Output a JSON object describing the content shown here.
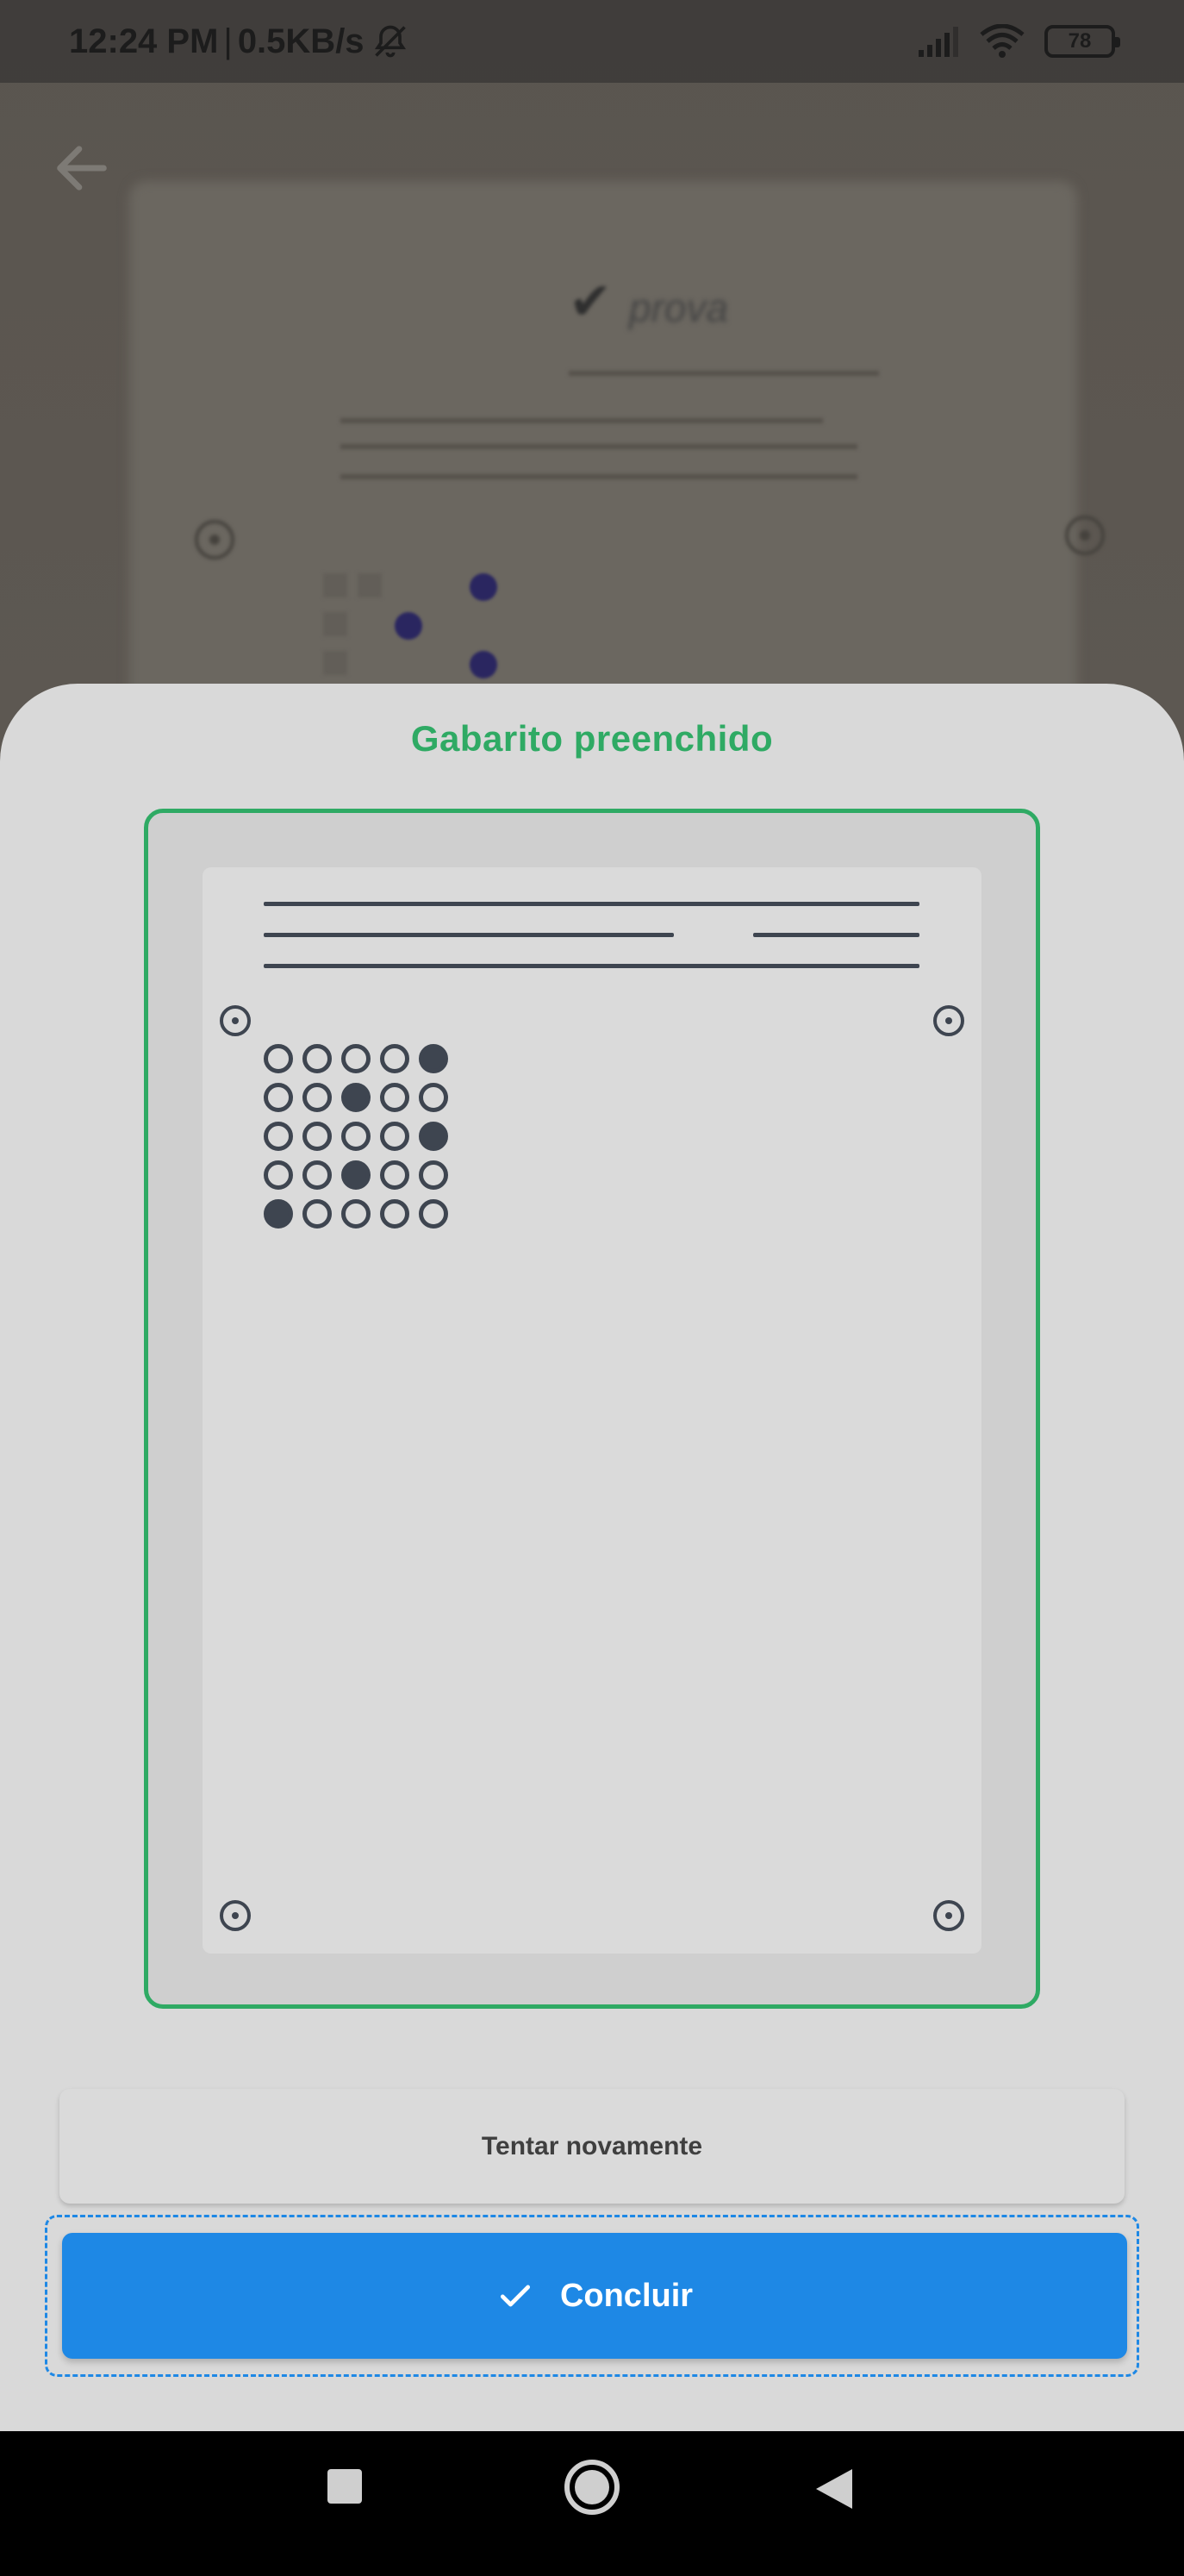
{
  "status_bar": {
    "time": "12:24 PM",
    "separator": "|",
    "speed": "0.5KB/s",
    "battery": "78"
  },
  "sheet": {
    "title": "Gabarito preenchido",
    "answer_grid": [
      [
        0,
        0,
        0,
        0,
        1
      ],
      [
        0,
        0,
        1,
        0,
        0
      ],
      [
        0,
        0,
        0,
        0,
        1
      ],
      [
        0,
        0,
        1,
        0,
        0
      ],
      [
        1,
        0,
        0,
        0,
        0
      ]
    ]
  },
  "actions": {
    "retry_label": "Tentar novamente",
    "confirm_label": "Concluir"
  },
  "colors": {
    "accent_green": "#2faa64",
    "primary_blue": "#1e88e5",
    "sheet_bg": "#d9d9d9",
    "ink": "#3e4550"
  },
  "icons": {
    "back": "arrow-left-icon",
    "confirm": "check-icon",
    "nav_recents": "square-icon",
    "nav_home": "circle-icon",
    "nav_back": "triangle-back-icon"
  }
}
